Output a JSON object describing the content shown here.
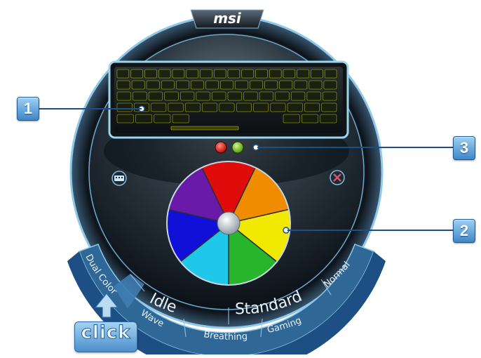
{
  "app": {
    "logo_text": "msi"
  },
  "callouts": {
    "c1": "1",
    "c2": "2",
    "c3": "3"
  },
  "colors": {
    "wheel": [
      "#e00c0c",
      "#f08c00",
      "#f1ea00",
      "#26b52b",
      "#1fc8e8",
      "#1010d8",
      "#6a1aa8"
    ],
    "accent": "#1e4f84",
    "key_glow": "#d6e600",
    "swatch_red": "#e31b12",
    "swatch_green": "#7ac222"
  },
  "icons": {
    "left": "keyboard-icon",
    "right": "close-icon"
  },
  "mode_tabs": {
    "dual_color": "Dual Color",
    "idle": "Idle",
    "standard": "Standard",
    "normal": "Normal",
    "wave": "Wave",
    "breathing": "Breathing",
    "gaming": "Gaming"
  },
  "hint": {
    "click": "click"
  }
}
